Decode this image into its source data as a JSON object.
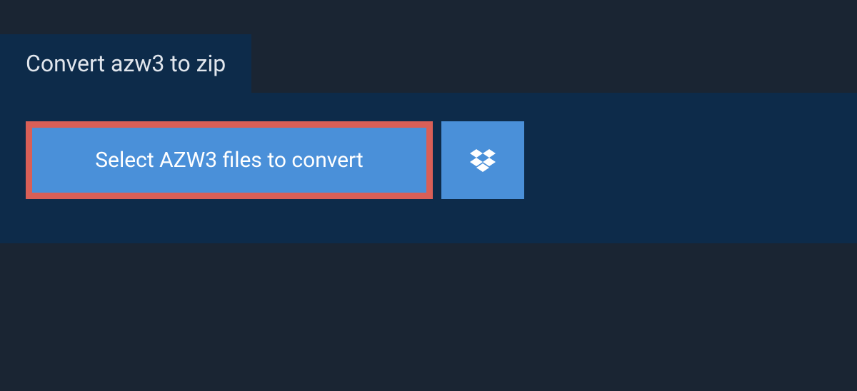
{
  "tab": {
    "title": "Convert azw3 to zip"
  },
  "panel": {
    "select_button_label": "Select AZW3 files to convert"
  }
}
